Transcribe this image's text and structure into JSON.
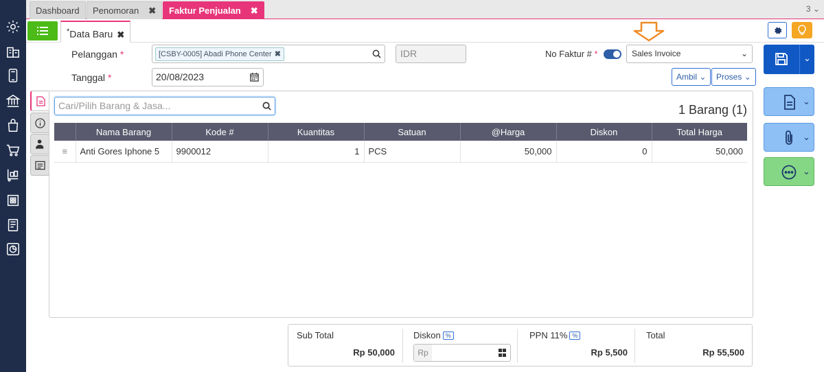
{
  "tabs": [
    {
      "label": "Dashboard"
    },
    {
      "label": "Penomoran"
    },
    {
      "label": "Faktur Penjualan"
    }
  ],
  "tab_count": "3",
  "doc_tab": {
    "marker": "*",
    "label": "Data Baru"
  },
  "form": {
    "customer_label": "Pelanggan",
    "customer_value": "[CSBY-0005] Abadi Phone Center",
    "currency": "IDR",
    "date_label": "Tanggal",
    "date_value": "20/08/2023",
    "invoice_no_label": "No Faktur #",
    "invoice_select_value": "Sales Invoice",
    "required_mark": "*",
    "ambil_label": "Ambil",
    "proses_label": "Proses"
  },
  "search": {
    "placeholder": "Cari/Pilih Barang & Jasa..."
  },
  "item_count": "1 Barang (1)",
  "table": {
    "headers": [
      "Nama Barang",
      "Kode #",
      "Kuantitas",
      "Satuan",
      "@Harga",
      "Diskon",
      "Total Harga"
    ],
    "rows": [
      {
        "name": "Anti Gores Iphone 5",
        "code": "9900012",
        "qty": "1",
        "unit": "PCS",
        "price": "50,000",
        "discount": "0",
        "total": "50,000"
      }
    ]
  },
  "totals": {
    "subtotal_label": "Sub Total",
    "subtotal_value": "Rp 50,000",
    "discount_label": "Diskon",
    "discount_currency": "Rp",
    "pct_symbol": "%",
    "tax_label": "PPN 11%",
    "tax_value": "Rp 5,500",
    "total_label": "Total",
    "total_value": "Rp 55,500"
  },
  "colors": {
    "accent": "#e8357a",
    "nav_bg": "#1f2d4b",
    "primary": "#1059c4",
    "arrow": "#f08a24"
  }
}
